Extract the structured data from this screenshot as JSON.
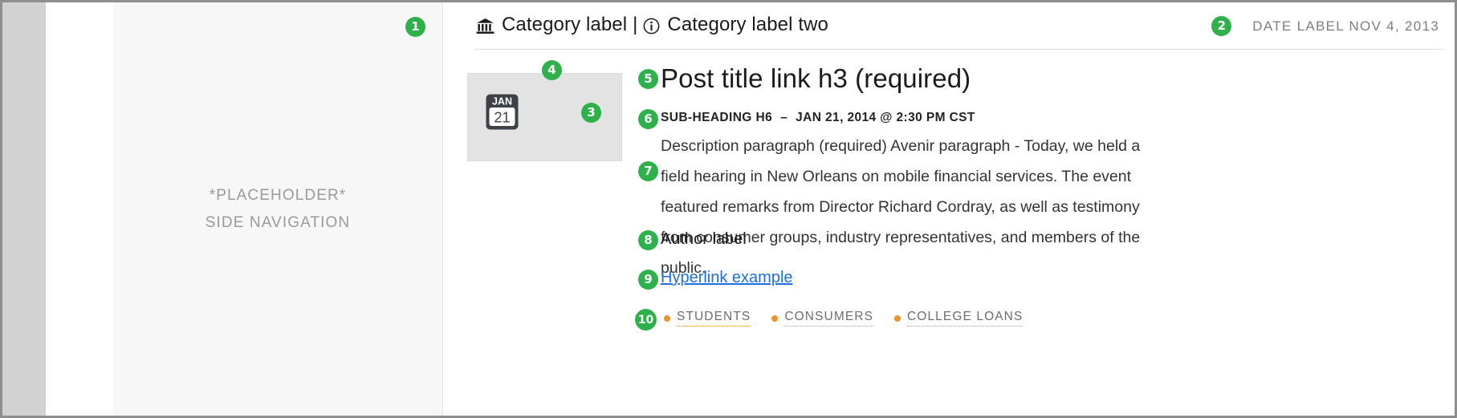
{
  "sidebar": {
    "line1": "*PLACEHOLDER*",
    "line2": "SIDE NAVIGATION"
  },
  "header": {
    "category_one": "Category label",
    "separator": "|",
    "category_two": "Category label two",
    "category_one_icon": "bank-institution-icon",
    "category_two_icon": "info-circle-icon",
    "date_label": "DATE LABEL NOV 4, 2013"
  },
  "thumbnail": {
    "calendar_icon": "calendar-icon",
    "calendar_month": "JAN",
    "calendar_day": "21"
  },
  "article": {
    "title": "Post title link h3 (required)",
    "subheading": "SUB-HEADING H6",
    "subheading_dash": "–",
    "subheading_date": "JAN 21, 2014 @ 2:30 PM CST",
    "description": "Description paragraph (required) Avenir paragraph - Today, we held a field hearing in New Orleans on mobile financial services. The event featured remarks from Director Richard Cordray, as well as testimony from consumer groups, industry representatives, and members of the public.",
    "author": "Author label",
    "hyperlink": "Hyperlink example",
    "tags": [
      {
        "label": "STUDENTS"
      },
      {
        "label": "CONSUMERS"
      },
      {
        "label": "COLLEGE LOANS"
      }
    ]
  },
  "callouts": [
    {
      "n": "1"
    },
    {
      "n": "2"
    },
    {
      "n": "3"
    },
    {
      "n": "4"
    },
    {
      "n": "5"
    },
    {
      "n": "6"
    },
    {
      "n": "7"
    },
    {
      "n": "8"
    },
    {
      "n": "9"
    },
    {
      "n": "10"
    }
  ],
  "colors": {
    "callout_green": "#2eb14a",
    "tag_orange": "#f0922c",
    "link_blue": "#1e6edb",
    "frame_gray": "#d2d2d2",
    "sidebar_gray": "#f7f7f7"
  }
}
